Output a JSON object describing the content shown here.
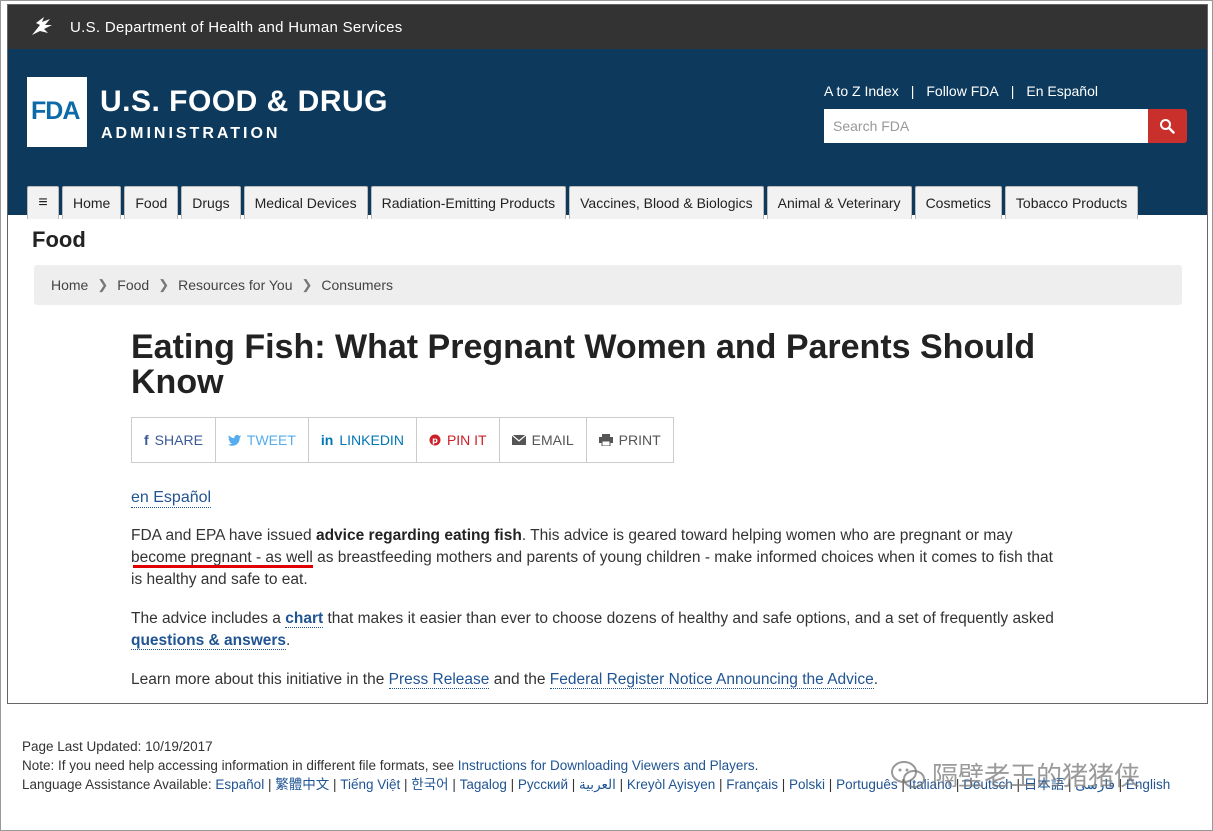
{
  "hhs": {
    "title": "U.S. Department of Health and Human Services"
  },
  "fda": {
    "logo": "FDA",
    "name_line1": "U.S. FOOD & DRUG",
    "name_line2": "ADMINISTRATION"
  },
  "utility_links": [
    "A to Z Index",
    "Follow FDA",
    "En Español"
  ],
  "search": {
    "placeholder": "Search FDA"
  },
  "nav": {
    "menu_icon": "≡",
    "tabs": [
      "Home",
      "Food",
      "Drugs",
      "Medical Devices",
      "Radiation-Emitting Products",
      "Vaccines, Blood & Biologics",
      "Animal & Veterinary",
      "Cosmetics",
      "Tobacco Products"
    ]
  },
  "section_title": "Food",
  "breadcrumb": [
    "Home",
    "Food",
    "Resources for You",
    "Consumers"
  ],
  "page_title": "Eating Fish: What Pregnant Women and Parents Should Know",
  "share": {
    "share": "SHARE",
    "tweet": "TWEET",
    "linkedin": "LINKEDIN",
    "pin": "PIN IT",
    "email": "EMAIL",
    "print": "PRINT"
  },
  "espanol_link": "en Español",
  "para1": {
    "a": "FDA and EPA have issued ",
    "bold": "advice regarding eating fish",
    "b": ". This advice is geared toward helping women who are pregnant or may become pregnant - as well as breastfeeding mothers and parents of young children - make informed choices when it comes to fish that is healthy and safe to eat."
  },
  "para2": {
    "a": "The advice includes a ",
    "link1": "chart",
    "b": " that makes it easier than ever to choose dozens of healthy and safe options, and a set of frequently asked ",
    "link2": "questions & answers",
    "c": "."
  },
  "para3": {
    "a": "Learn more about this initiative in the ",
    "link1": "Press Release",
    "b": " and the ",
    "link2": "Federal Register Notice Announcing the Advice",
    "c": "."
  },
  "footer": {
    "updated": "Page Last Updated: 10/19/2017",
    "note_a": "Note: If you need help accessing information in different file formats, see ",
    "note_link": "Instructions for Downloading Viewers and Players",
    "note_b": ".",
    "lang_label": "Language Assistance Available: ",
    "languages": [
      "Español",
      "繁體中文",
      "Tiếng Việt",
      "한국어",
      "Tagalog",
      "Русский",
      "العربية",
      "Kreyòl Ayisyen",
      "Français",
      "Polski",
      "Português",
      "Italiano",
      "Deutsch",
      "日本語",
      "فارسی",
      "English"
    ]
  },
  "watermark": {
    "text": "隔壁老王的猪猪侠"
  },
  "colors": {
    "hhs_bar": "#333333",
    "header_bg": "#0d3a5c",
    "search_btn": "#c9302c",
    "link": "#205493",
    "annotation": "#e00000"
  }
}
